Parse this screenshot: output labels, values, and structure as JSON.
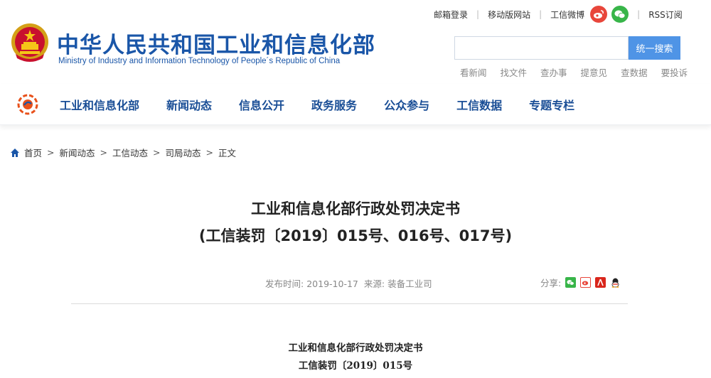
{
  "header": {
    "site_title": "中华人民共和国工业和信息化部",
    "site_subtitle": "Ministry of Industry and Information Technology of People´s Republic of China",
    "top_links": {
      "mail_login": "邮箱登录",
      "mobile_site": "移动版网站",
      "weibo": "工信微博",
      "rss": "RSS订阅"
    },
    "search": {
      "placeholder": "",
      "button_label": "统一搜索"
    },
    "quick_links": [
      "看新闻",
      "找文件",
      "查办事",
      "提意见",
      "查数据",
      "要投诉"
    ]
  },
  "nav": {
    "items": [
      "工业和信息化部",
      "新闻动态",
      "信息公开",
      "政务服务",
      "公众参与",
      "工信数据",
      "专题专栏"
    ]
  },
  "breadcrumb": {
    "items": [
      "首页",
      "新闻动态",
      "工信动态",
      "司局动态",
      "正文"
    ],
    "separator": ">"
  },
  "article": {
    "title_line1": "工业和信息化部行政处罚决定书",
    "title_line2": "(工信装罚〔2019〕015号、016号、017号)",
    "meta": {
      "publish_label": "发布时间:",
      "publish_date": "2019-10-17",
      "source_label": "来源:",
      "source": "装备工业司"
    },
    "share_label": "分享:",
    "body_heading1": "工业和信息化部行政处罚决定书",
    "body_heading2": "工信装罚〔2019〕015号"
  },
  "colors": {
    "brand_blue": "#1a56a8",
    "search_button": "#4f94e6",
    "weibo_red": "#e8463b",
    "wechat_green": "#38b549"
  },
  "icons": {
    "emblem": "national-emblem-icon",
    "nav_logo": "miit-logo-icon",
    "home": "home-icon",
    "weibo": "weibo-icon",
    "wechat": "wechat-icon",
    "share": [
      "wechat-share-icon",
      "weibo-share-icon",
      "renren-share-icon",
      "qq-share-icon"
    ]
  }
}
